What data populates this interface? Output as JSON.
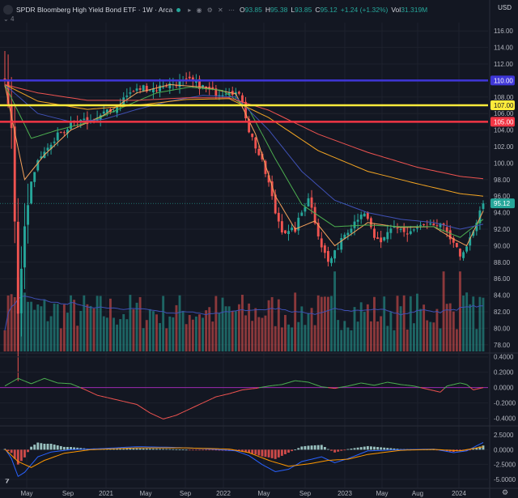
{
  "header": {
    "title": "SPDR Bloomberg High Yield Bond ETF · 1W · Arca",
    "ohlc": [
      {
        "label": "O",
        "value": "93.85"
      },
      {
        "label": "H",
        "value": "95.38"
      },
      {
        "label": "L",
        "value": "93.85"
      },
      {
        "label": "C",
        "value": "95.12"
      }
    ],
    "change": "+1.24 (+1.32%)",
    "vol_label": "Vol",
    "vol_value": "31.319M",
    "indicator_count": "4",
    "currency": "USD",
    "icons": [
      "collapse-icon",
      "eye-icon",
      "settings-icon",
      "close-icon",
      "more-icon"
    ]
  },
  "colors": {
    "background": "#131722",
    "up": "#26a69a",
    "down": "#ef5350",
    "grid": "#1e222d",
    "axis_text": "#b2b5be",
    "line_110": "#3f37d8",
    "line_107": "#ffeb3b",
    "line_105": "#f23645",
    "price_tag": "#26a69a",
    "ma_fast": "#f7a35c",
    "ma_mid": "#4caf50",
    "ma_slow": "#3f51b5",
    "ma_long1": "#f5a623",
    "ma_long2": "#ef5350"
  },
  "chart_data": [
    {
      "type": "candlestick",
      "panel": "price",
      "y_ticks": [
        "116.00",
        "114.00",
        "112.00",
        "110.00",
        "108.00",
        "106.00",
        "104.00",
        "102.00",
        "100.00",
        "98.00",
        "96.00",
        "94.00",
        "92.00",
        "90.00",
        "88.00",
        "86.00",
        "84.00",
        "82.00",
        "80.00",
        "78.00"
      ],
      "ylim": [
        77,
        117
      ],
      "x_ticks": [
        "May",
        "Sep",
        "2021",
        "May",
        "Sep",
        "2022",
        "May",
        "Sep",
        "2023",
        "May",
        "Aug",
        "2024"
      ],
      "horizontal_levels": [
        {
          "value": 110.0,
          "label": "110.00",
          "color": "#3f37d8"
        },
        {
          "value": 107.0,
          "label": "107.00",
          "color": "#ffeb3b"
        },
        {
          "value": 105.0,
          "label": "105.00",
          "color": "#f23645"
        }
      ],
      "last_price": {
        "value": 95.12,
        "label": "95.12"
      },
      "close_anchors": [
        [
          0,
          109.5
        ],
        [
          2,
          104
        ],
        [
          4,
          82
        ],
        [
          6,
          92
        ],
        [
          8,
          98
        ],
        [
          10,
          100
        ],
        [
          12,
          101.5
        ],
        [
          14,
          102
        ],
        [
          16,
          103.5
        ],
        [
          18,
          104
        ],
        [
          20,
          104.5
        ],
        [
          22,
          104.8
        ],
        [
          24,
          105
        ],
        [
          26,
          105
        ],
        [
          28,
          105.5
        ],
        [
          30,
          106
        ],
        [
          32,
          106.2
        ],
        [
          34,
          107
        ],
        [
          36,
          107.8
        ],
        [
          38,
          108.5
        ],
        [
          40,
          108.8
        ],
        [
          42,
          109.2
        ],
        [
          44,
          109
        ],
        [
          46,
          109
        ],
        [
          48,
          109.4
        ],
        [
          50,
          109.5
        ],
        [
          52,
          109.7
        ],
        [
          54,
          109.8
        ],
        [
          56,
          109.9
        ],
        [
          58,
          109.6
        ],
        [
          60,
          109.2
        ],
        [
          62,
          108.8
        ],
        [
          64,
          108.5
        ],
        [
          66,
          108.6
        ],
        [
          68,
          108.9
        ],
        [
          70,
          108.5
        ],
        [
          72,
          107.5
        ],
        [
          74,
          104
        ],
        [
          76,
          102
        ],
        [
          78,
          100
        ],
        [
          80,
          97.5
        ],
        [
          82,
          94
        ],
        [
          84,
          92
        ],
        [
          86,
          91.5
        ],
        [
          88,
          92
        ],
        [
          90,
          94
        ],
        [
          92,
          96
        ],
        [
          94,
          93
        ],
        [
          96,
          90
        ],
        [
          98,
          88
        ],
        [
          100,
          89
        ],
        [
          102,
          91
        ],
        [
          104,
          92
        ],
        [
          106,
          93
        ],
        [
          108,
          94
        ],
        [
          110,
          93
        ],
        [
          112,
          91
        ],
        [
          114,
          90
        ],
        [
          116,
          91.5
        ],
        [
          118,
          92.5
        ],
        [
          120,
          92
        ],
        [
          122,
          91.3
        ],
        [
          124,
          91.8
        ],
        [
          126,
          92.3
        ],
        [
          128,
          92
        ],
        [
          130,
          92.5
        ],
        [
          132,
          92.3
        ],
        [
          134,
          91.8
        ],
        [
          136,
          90.5
        ],
        [
          138,
          88.5
        ],
        [
          140,
          89.5
        ],
        [
          142,
          92
        ],
        [
          144,
          94
        ],
        [
          145,
          95.12
        ]
      ],
      "ma_series": [
        {
          "name": "MA fast",
          "values": [
            [
              0,
              109.5
            ],
            [
              6,
              98
            ],
            [
              12,
              101
            ],
            [
              20,
              104
            ],
            [
              30,
              105.8
            ],
            [
              40,
              108.5
            ],
            [
              50,
              109.5
            ],
            [
              60,
              109.2
            ],
            [
              70,
              108.4
            ],
            [
              76,
              103.5
            ],
            [
              82,
              96
            ],
            [
              88,
              92
            ],
            [
              94,
              93
            ],
            [
              100,
              90
            ],
            [
              110,
              92.8
            ],
            [
              120,
              92.2
            ],
            [
              130,
              92.3
            ],
            [
              136,
              90.8
            ],
            [
              140,
              90
            ],
            [
              145,
              94.2
            ]
          ]
        },
        {
          "name": "MA mid",
          "values": [
            [
              0,
              109.5
            ],
            [
              8,
              103
            ],
            [
              16,
              104
            ],
            [
              26,
              105
            ],
            [
              36,
              106.8
            ],
            [
              46,
              108.5
            ],
            [
              56,
              109.2
            ],
            [
              66,
              108.8
            ],
            [
              74,
              106.5
            ],
            [
              82,
              100.5
            ],
            [
              90,
              95
            ],
            [
              100,
              92.3
            ],
            [
              110,
              92.5
            ],
            [
              120,
              92.3
            ],
            [
              130,
              92.3
            ],
            [
              138,
              91
            ],
            [
              145,
              93.2
            ]
          ]
        },
        {
          "name": "MA slow",
          "values": [
            [
              0,
              109.5
            ],
            [
              10,
              106
            ],
            [
              20,
              105
            ],
            [
              30,
              105.3
            ],
            [
              40,
              106.5
            ],
            [
              50,
              107.5
            ],
            [
              60,
              108.2
            ],
            [
              70,
              108
            ],
            [
              80,
              104
            ],
            [
              90,
              99
            ],
            [
              100,
              95.5
            ],
            [
              110,
              94
            ],
            [
              120,
              93.2
            ],
            [
              130,
              92.8
            ],
            [
              138,
              92
            ],
            [
              145,
              92.6
            ]
          ]
        },
        {
          "name": "MA long 1",
          "values": [
            [
              0,
              109.5
            ],
            [
              10,
              107.5
            ],
            [
              25,
              106.5
            ],
            [
              40,
              107
            ],
            [
              55,
              107.7
            ],
            [
              68,
              107.8
            ],
            [
              80,
              105.5
            ],
            [
              95,
              101.5
            ],
            [
              110,
              99
            ],
            [
              125,
              97.5
            ],
            [
              138,
              96.3
            ],
            [
              145,
              96
            ]
          ]
        },
        {
          "name": "MA long 2",
          "values": [
            [
              0,
              109.5
            ],
            [
              10,
              108.5
            ],
            [
              25,
              107.6
            ],
            [
              40,
              107.6
            ],
            [
              55,
              107.9
            ],
            [
              68,
              107.9
            ],
            [
              80,
              106.4
            ],
            [
              95,
              103.5
            ],
            [
              110,
              101.3
            ],
            [
              125,
              99.5
            ],
            [
              138,
              98.4
            ],
            [
              145,
              98.1
            ]
          ]
        }
      ]
    },
    {
      "type": "bar",
      "panel": "volume",
      "description_free": true,
      "ma_color": "#3f51b5"
    },
    {
      "type": "line",
      "panel": "oscillator",
      "y_ticks": [
        "0.4000",
        "0.2000",
        "0.0000",
        "-0.2000",
        "-0.4000"
      ],
      "ylim": [
        -0.5,
        0.45
      ],
      "values": [
        [
          0,
          0.02
        ],
        [
          4,
          0.12
        ],
        [
          8,
          0.05
        ],
        [
          12,
          0.12
        ],
        [
          16,
          0.06
        ],
        [
          20,
          0.05
        ],
        [
          24,
          -0.02
        ],
        [
          28,
          -0.1
        ],
        [
          32,
          -0.14
        ],
        [
          36,
          -0.18
        ],
        [
          40,
          -0.22
        ],
        [
          44,
          -0.33
        ],
        [
          48,
          -0.41
        ],
        [
          52,
          -0.36
        ],
        [
          56,
          -0.28
        ],
        [
          60,
          -0.2
        ],
        [
          64,
          -0.12
        ],
        [
          68,
          -0.08
        ],
        [
          72,
          -0.03
        ],
        [
          76,
          -0.01
        ],
        [
          80,
          0.02
        ],
        [
          84,
          0.04
        ],
        [
          88,
          0.09
        ],
        [
          92,
          0.07
        ],
        [
          96,
          0.01
        ],
        [
          100,
          -0.01
        ],
        [
          104,
          0.02
        ],
        [
          108,
          0.06
        ],
        [
          112,
          0.03
        ],
        [
          116,
          0.07
        ],
        [
          120,
          0.04
        ],
        [
          124,
          0.02
        ],
        [
          128,
          -0.02
        ],
        [
          132,
          -0.06
        ],
        [
          134,
          0.02
        ],
        [
          138,
          0.06
        ],
        [
          140,
          0.04
        ],
        [
          142,
          -0.03
        ],
        [
          145,
          0.0
        ]
      ]
    },
    {
      "type": "bar",
      "panel": "macd",
      "y_ticks": [
        "2.5000",
        "0.0000",
        "-2.5000",
        "-5.0000"
      ],
      "ylim": [
        -6.5,
        4
      ],
      "macd_line": [
        [
          0,
          0.2
        ],
        [
          2,
          -1.5
        ],
        [
          4,
          -4.5
        ],
        [
          6,
          -3.8
        ],
        [
          8,
          -2.5
        ],
        [
          10,
          -1.2
        ],
        [
          14,
          -0.4
        ],
        [
          20,
          0
        ],
        [
          30,
          0.2
        ],
        [
          40,
          0.5
        ],
        [
          50,
          0.4
        ],
        [
          60,
          0.2
        ],
        [
          70,
          -0.2
        ],
        [
          74,
          -1
        ],
        [
          78,
          -2.5
        ],
        [
          82,
          -3.7
        ],
        [
          86,
          -3.3
        ],
        [
          90,
          -2
        ],
        [
          96,
          -1.2
        ],
        [
          100,
          -2.2
        ],
        [
          104,
          -1.5
        ],
        [
          110,
          -0.2
        ],
        [
          120,
          0
        ],
        [
          130,
          0.1
        ],
        [
          136,
          -0.5
        ],
        [
          140,
          -0.2
        ],
        [
          145,
          1.2
        ]
      ],
      "signal_line": [
        [
          0,
          0.1
        ],
        [
          4,
          -2
        ],
        [
          8,
          -3
        ],
        [
          12,
          -1.8
        ],
        [
          18,
          -0.6
        ],
        [
          26,
          0
        ],
        [
          40,
          0.3
        ],
        [
          55,
          0.3
        ],
        [
          68,
          0.1
        ],
        [
          74,
          -0.5
        ],
        [
          80,
          -1.8
        ],
        [
          86,
          -2.8
        ],
        [
          92,
          -2.4
        ],
        [
          98,
          -1.8
        ],
        [
          104,
          -1.6
        ],
        [
          110,
          -0.8
        ],
        [
          120,
          -0.1
        ],
        [
          130,
          0.05
        ],
        [
          138,
          -0.2
        ],
        [
          145,
          0.5
        ]
      ]
    }
  ]
}
